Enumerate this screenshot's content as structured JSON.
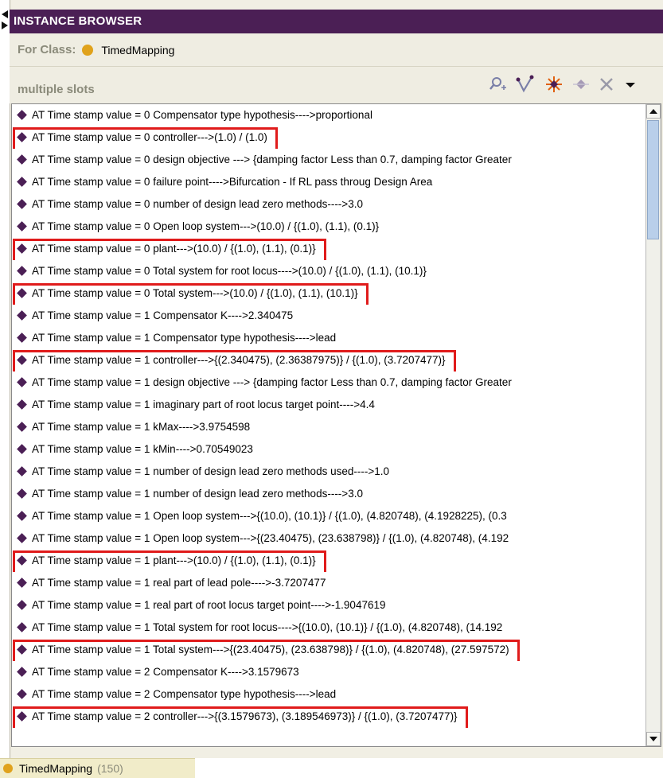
{
  "window": {
    "title": "INSTANCE BROWSER"
  },
  "for_class": {
    "label": "For Class:",
    "class_name": "TimedMapping",
    "dot_color": "#e0a21c"
  },
  "slots": {
    "label": "multiple slots",
    "tools": [
      "search-instance-icon",
      "add-instance-icon",
      "create-instance-icon",
      "delete-instance-icon",
      "remove-icon",
      "menu-dropdown-icon"
    ]
  },
  "colors": {
    "title_bg": "#4b1f55",
    "highlight": "#e01b1b",
    "diamond": "#4b1f55"
  },
  "rows": [
    {
      "text": "AT Time stamp value = 0 Compensator type hypothesis---->proportional",
      "highlight": false
    },
    {
      "text": "AT Time stamp value = 0 controller--->(1.0) / (1.0)",
      "highlight": true
    },
    {
      "text": "AT Time stamp value = 0 design objective ---> {damping factor Less than 0.7, damping factor Greater",
      "highlight": false
    },
    {
      "text": "AT Time stamp value = 0 failure point---->Bifurcation - If RL pass throug Design Area",
      "highlight": false
    },
    {
      "text": "AT Time stamp value = 0 number of design lead zero methods---->3.0",
      "highlight": false
    },
    {
      "text": "AT Time stamp value = 0 Open loop system--->(10.0) / {(1.0), (1.1), (0.1)}",
      "highlight": false
    },
    {
      "text": "AT Time stamp value = 0 plant--->(10.0) / {(1.0), (1.1), (0.1)}",
      "highlight": true
    },
    {
      "text": "AT Time stamp value = 0 Total system for root locus---->(10.0) / {(1.0), (1.1), (10.1)}",
      "highlight": false
    },
    {
      "text": "AT Time stamp value = 0 Total system--->(10.0) / {(1.0), (1.1), (10.1)}",
      "highlight": true
    },
    {
      "text": "AT Time stamp value = 1 Compensator K---->2.340475",
      "highlight": false
    },
    {
      "text": "AT Time stamp value = 1 Compensator type hypothesis---->lead",
      "highlight": false
    },
    {
      "text": "AT Time stamp value = 1 controller--->{(2.340475), (2.36387975)} / {(1.0), (3.7207477)}",
      "highlight": true
    },
    {
      "text": "AT Time stamp value = 1 design objective ---> {damping factor Less than 0.7, damping factor Greater",
      "highlight": false
    },
    {
      "text": "AT Time stamp value = 1 imaginary part of root locus target point---->4.4",
      "highlight": false
    },
    {
      "text": "AT Time stamp value = 1 kMax---->3.9754598",
      "highlight": false
    },
    {
      "text": "AT Time stamp value = 1 kMin---->0.70549023",
      "highlight": false
    },
    {
      "text": "AT Time stamp value = 1 number of design lead zero methods used---->1.0",
      "highlight": false
    },
    {
      "text": "AT Time stamp value = 1 number of design lead zero methods---->3.0",
      "highlight": false
    },
    {
      "text": "AT Time stamp value = 1 Open loop system--->{(10.0), (10.1)} / {(1.0), (4.820748), (4.1928225), (0.3",
      "highlight": false
    },
    {
      "text": "AT Time stamp value = 1 Open loop system--->{(23.40475), (23.638798)} / {(1.0), (4.820748), (4.192",
      "highlight": false
    },
    {
      "text": "AT Time stamp value = 1 plant--->(10.0) / {(1.0), (1.1), (0.1)}",
      "highlight": true
    },
    {
      "text": "AT Time stamp value = 1 real part of lead pole---->-3.7207477",
      "highlight": false
    },
    {
      "text": "AT Time stamp value = 1 real part of root locus target point---->-1.9047619",
      "highlight": false
    },
    {
      "text": "AT Time stamp value = 1 Total system for root locus---->{(10.0), (10.1)} / {(1.0), (4.820748), (14.192",
      "highlight": false
    },
    {
      "text": "AT Time stamp value = 1 Total system--->{(23.40475), (23.638798)} / {(1.0), (4.820748), (27.597572)",
      "highlight": true
    },
    {
      "text": "AT Time stamp value = 2 Compensator K---->3.1579673",
      "highlight": false
    },
    {
      "text": "AT Time stamp value = 2 Compensator type hypothesis---->lead",
      "highlight": false
    },
    {
      "text": "AT Time stamp value = 2 controller--->{(3.1579673), (3.189546973)} / {(1.0), (3.7207477)}",
      "highlight": true
    }
  ],
  "footer": {
    "tab_label": "TimedMapping",
    "count": "(150)"
  }
}
